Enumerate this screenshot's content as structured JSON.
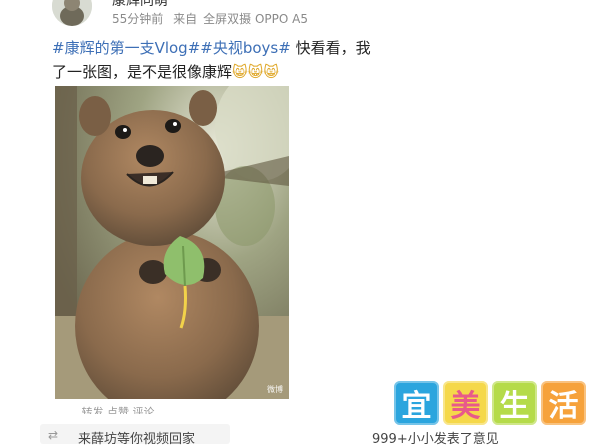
{
  "post": {
    "username": "康辉同萌",
    "time": "55分钟前",
    "source_prefix": "来自",
    "device": "全屏双摄 OPPO A5",
    "hashtag1": "#康辉的第一支Vlog#",
    "hashtag2": "#央视boys#",
    "text": " 快看看，我了一张图，是不是很像康辉",
    "emojis": "😸😸😸"
  },
  "photo": {
    "watermark": "微博"
  },
  "below_photo_text": "……  转发 点赞 评论",
  "bottom": {
    "left_icon": "⇄",
    "left_text": "来薛坊等你视频回家",
    "right_text": "999+小小发表了意见"
  },
  "logo": {
    "chars": [
      "宜",
      "美",
      "生",
      "活"
    ]
  },
  "colors": {
    "hashtag": "#3d6fb6",
    "meta": "#8a8a8a",
    "logo_tiles": [
      "#2ba5de",
      "#f5d84a",
      "#b5db4a",
      "#f6a23b"
    ]
  }
}
